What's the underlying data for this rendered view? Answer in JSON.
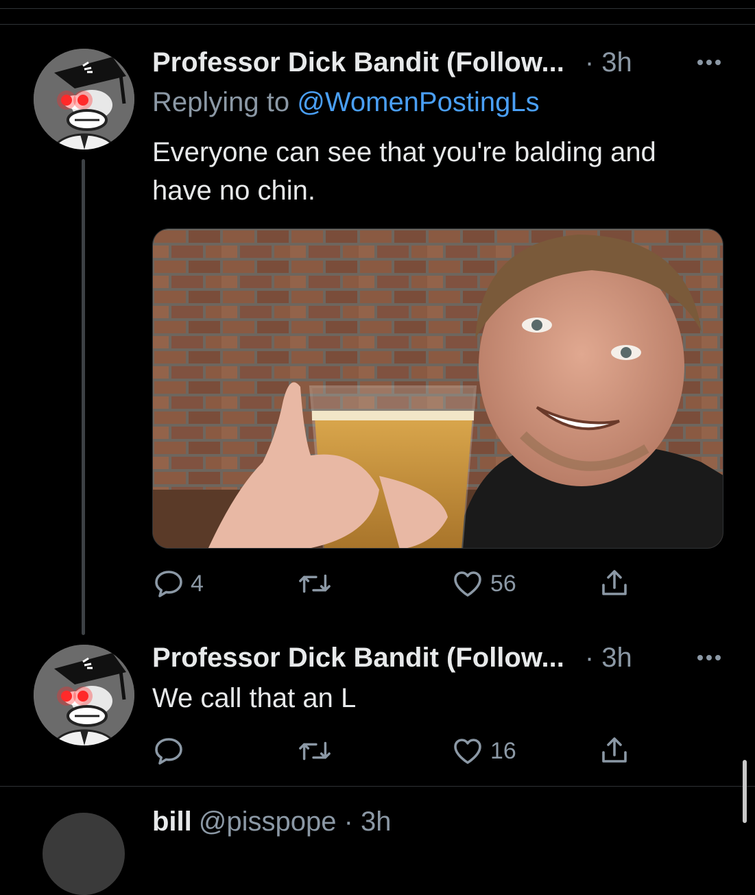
{
  "tweets": [
    {
      "display_name": "Professor Dick Bandit (Follow...",
      "time": "· 3h",
      "replying_prefix": "Replying to ",
      "replying_handle": "@WomenPostingLs",
      "text_line1": "Everyone can see that you're balding and",
      "text_line2": "have no chin.",
      "media_alt": "selfie of man with beer in front of brick wall",
      "reply_count": "4",
      "retweet_count": "",
      "like_count": "56"
    },
    {
      "display_name": "Professor Dick Bandit (Follow...",
      "time": "· 3h",
      "text": "We call that an L",
      "reply_count": "",
      "retweet_count": "",
      "like_count": "16"
    }
  ],
  "next_tweet": {
    "display_name": "bill",
    "handle": "@pisspope · 3h"
  },
  "icons": [
    "reply-icon",
    "retweet-icon",
    "like-icon",
    "share-icon",
    "more-icon"
  ],
  "colors": {
    "background": "#000000",
    "text": "#e7e9ea",
    "secondary": "#8b98a5",
    "link": "#4a9ff5",
    "avatar_eyes": "#ff2a2a"
  }
}
